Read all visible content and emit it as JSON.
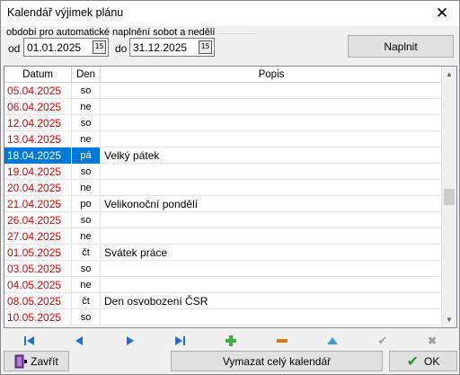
{
  "window": {
    "title": "Kalendář výjimek plánu"
  },
  "range": {
    "legend": "období pro automatické naplnění sobot a nedělí",
    "from_label": "od",
    "from_value": "01.01.2025",
    "to_label": "do",
    "to_value": "31.12.2025",
    "fill_button": "Naplnit"
  },
  "grid": {
    "columns": [
      "Datum",
      "Den",
      "Popis"
    ],
    "rows": [
      {
        "date": "05.04.2025",
        "day": "so",
        "desc": ""
      },
      {
        "date": "06.04.2025",
        "day": "ne",
        "desc": ""
      },
      {
        "date": "12.04.2025",
        "day": "so",
        "desc": ""
      },
      {
        "date": "13.04.2025",
        "day": "ne",
        "desc": ""
      },
      {
        "date": "18.04.2025",
        "day": "pá",
        "desc": "Velký pátek"
      },
      {
        "date": "19.04.2025",
        "day": "so",
        "desc": ""
      },
      {
        "date": "20.04.2025",
        "day": "ne",
        "desc": ""
      },
      {
        "date": "21.04.2025",
        "day": "po",
        "desc": "Velikonoční pondělí"
      },
      {
        "date": "26.04.2025",
        "day": "so",
        "desc": ""
      },
      {
        "date": "27.04.2025",
        "day": "ne",
        "desc": ""
      },
      {
        "date": "01.05.2025",
        "day": "čt",
        "desc": "Svátek práce"
      },
      {
        "date": "03.05.2025",
        "day": "so",
        "desc": ""
      },
      {
        "date": "04.05.2025",
        "day": "ne",
        "desc": ""
      },
      {
        "date": "08.05.2025",
        "day": "čt",
        "desc": "Den osvobození ČSR"
      },
      {
        "date": "10.05.2025",
        "day": "so",
        "desc": ""
      }
    ]
  },
  "footer": {
    "close_button": "Zavřít",
    "clear_button": "Vymazat celý kalendář",
    "ok_button": "OK"
  },
  "colors": {
    "date_text": "#e00000",
    "selection": "#0078d7",
    "accent_blue": "#1b6fd6",
    "add_green": "#3fae3f",
    "ok_green": "#2a9a2a"
  }
}
